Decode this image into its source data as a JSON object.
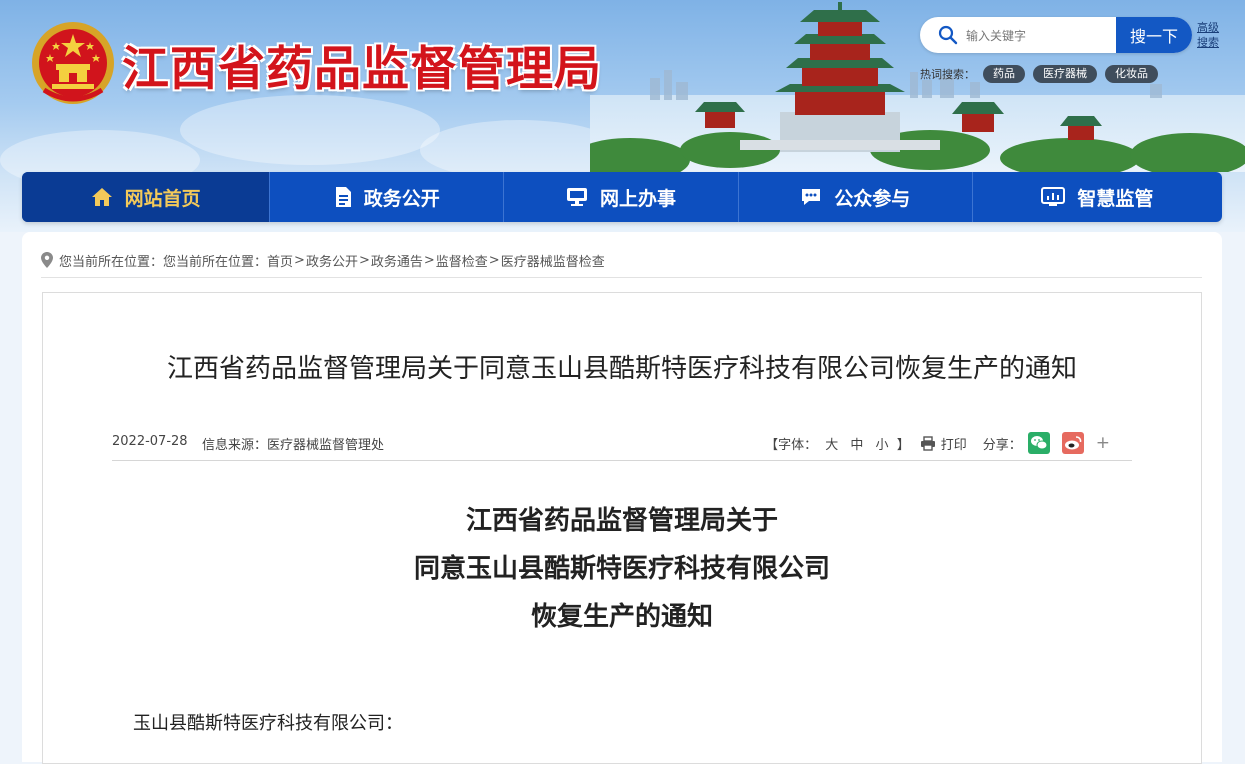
{
  "site": {
    "title": "江西省药品监督管理局"
  },
  "search": {
    "placeholder": "输入关键字",
    "button_label": "搜一下",
    "advanced_label": "高级搜索",
    "hot_label": "热词搜索：",
    "hot_tags": [
      "药品",
      "医疗器械",
      "化妆品"
    ]
  },
  "nav": {
    "items": [
      {
        "label": "网站首页",
        "icon": "home-icon",
        "active": true
      },
      {
        "label": "政务公开",
        "icon": "document-icon",
        "active": false
      },
      {
        "label": "网上办事",
        "icon": "monitor-icon",
        "active": false
      },
      {
        "label": "公众参与",
        "icon": "chat-icon",
        "active": false
      },
      {
        "label": "智慧监管",
        "icon": "dashboard-icon",
        "active": false
      }
    ]
  },
  "breadcrumb": {
    "prefix": "您当前所在位置：您当前所在位置：",
    "items": [
      "首页",
      "政务公开",
      "政务通告",
      "监督检查",
      "医疗器械监督检查"
    ]
  },
  "article": {
    "title": "江西省药品监督管理局关于同意玉山县酷斯特医疗科技有限公司恢复生产的通知",
    "date": "2022-07-28",
    "source": "信息来源：医疗器械监督管理处",
    "font_label_open": "【字体：",
    "font_sizes": [
      "大",
      "中",
      "小"
    ],
    "font_label_close": "】",
    "print_label": "打印",
    "share_label": "分享：",
    "share_more": "+",
    "heading_lines": [
      "江西省药品监督管理局关于",
      "同意玉山县酷斯特医疗科技有限公司",
      "恢复生产的通知"
    ],
    "salutation": "玉山县酷斯特医疗科技有限公司："
  },
  "colors": {
    "brand_red": "#d3141b",
    "nav_blue": "#0d4fbf",
    "nav_active": "#0a3b94",
    "nav_active_text": "#f3c95a",
    "wechat_green": "#2aae67",
    "weibo_red": "#e66a5f"
  }
}
